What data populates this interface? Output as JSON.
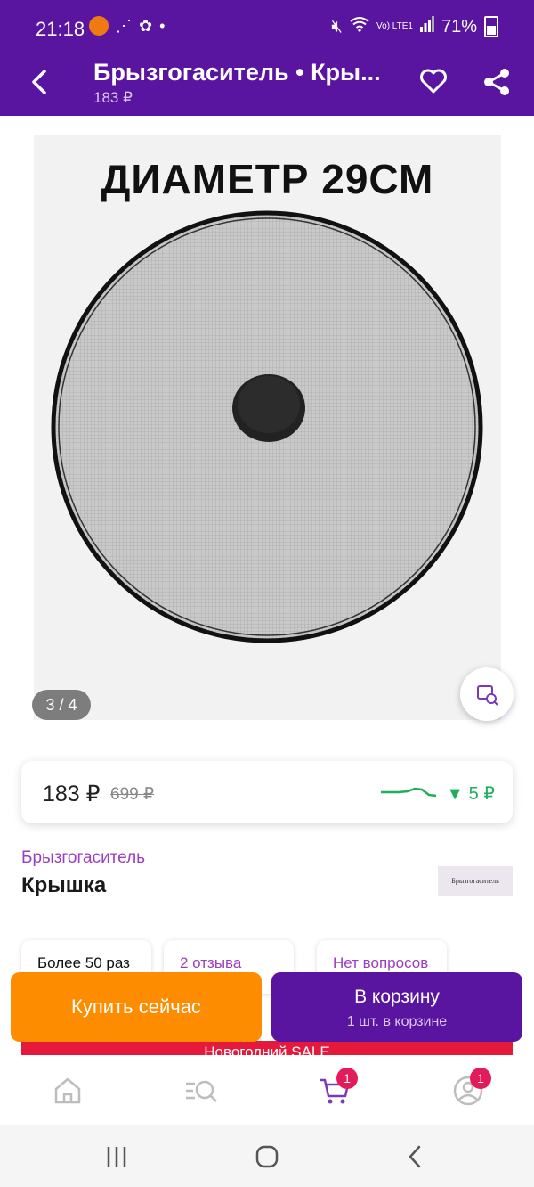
{
  "status_bar": {
    "time": "21:18",
    "network": "Vo) LTE1",
    "battery": "71%"
  },
  "app_bar": {
    "title": "Брызгогаситель • Кры...",
    "subtitle": "183 ₽"
  },
  "gallery": {
    "image_title": "ДИАМЕТР  29СМ",
    "counter": "3 / 4"
  },
  "price_card": {
    "price": "183 ₽",
    "old_price": "699 ₽",
    "drop": "▼ 5 ₽"
  },
  "product": {
    "brand": "Брызгогаситель",
    "name": "Крышка",
    "brand_logo_text": "Брызгогаситель"
  },
  "chips": [
    {
      "label": "Более 50 раз"
    },
    {
      "label": "2 отзыва"
    },
    {
      "label": "Нет вопросов"
    }
  ],
  "sale_banner": "Новогодний SALE",
  "actions": {
    "buy_now": "Купить сейчас",
    "cart_label": "В корзину",
    "cart_sub": "1 шт. в корзине"
  },
  "bottom_nav": {
    "cart_badge": "1",
    "profile_badge": "1"
  },
  "colors": {
    "brand": "#5a15a0",
    "buy_now": "#fe8c00",
    "price_drop": "#1fae5b",
    "badge": "#e41b5b",
    "sale": "#e4193b"
  }
}
